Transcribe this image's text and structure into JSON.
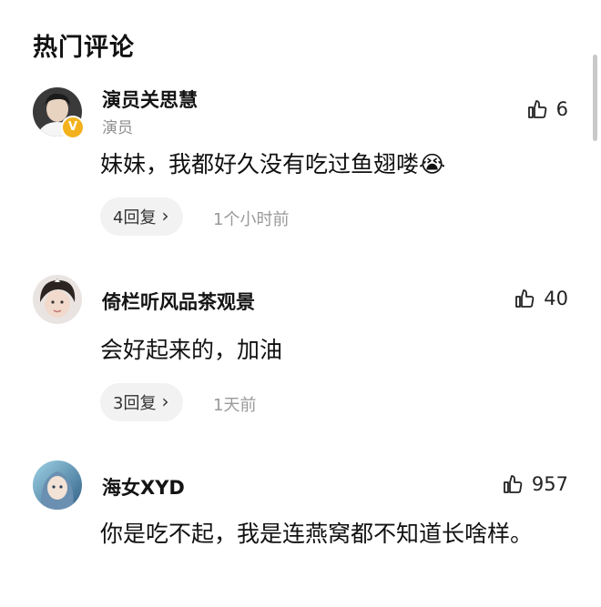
{
  "header": {
    "title": "热门评论"
  },
  "comments": [
    {
      "username": "演员关思慧",
      "tag": "演员",
      "verified_badge": "V",
      "avatar_icon": "user-avatar-verified",
      "likes": "6",
      "text": "妹妹，我都好久没有吃过鱼翅喽😭",
      "replies_label": "4回复",
      "time": "1个小时前"
    },
    {
      "username": "倚栏听风品茶观景",
      "likes": "40",
      "avatar_icon": "user-avatar-child",
      "text": "会好起来的，加油",
      "replies_label": "3回复",
      "time": "1天前"
    },
    {
      "username": "海女XYD",
      "likes": "957",
      "avatar_icon": "user-avatar-illustrated",
      "text": "你是吃不起，我是连燕窝都不知道长啥样。"
    }
  ],
  "icons": {
    "like": "thumbs-up-icon",
    "chevron": "chevron-right-icon"
  },
  "colors": {
    "badge": "#f3b21d",
    "pill_bg": "#f2f2f2",
    "muted_text": "#9a9a9a"
  }
}
